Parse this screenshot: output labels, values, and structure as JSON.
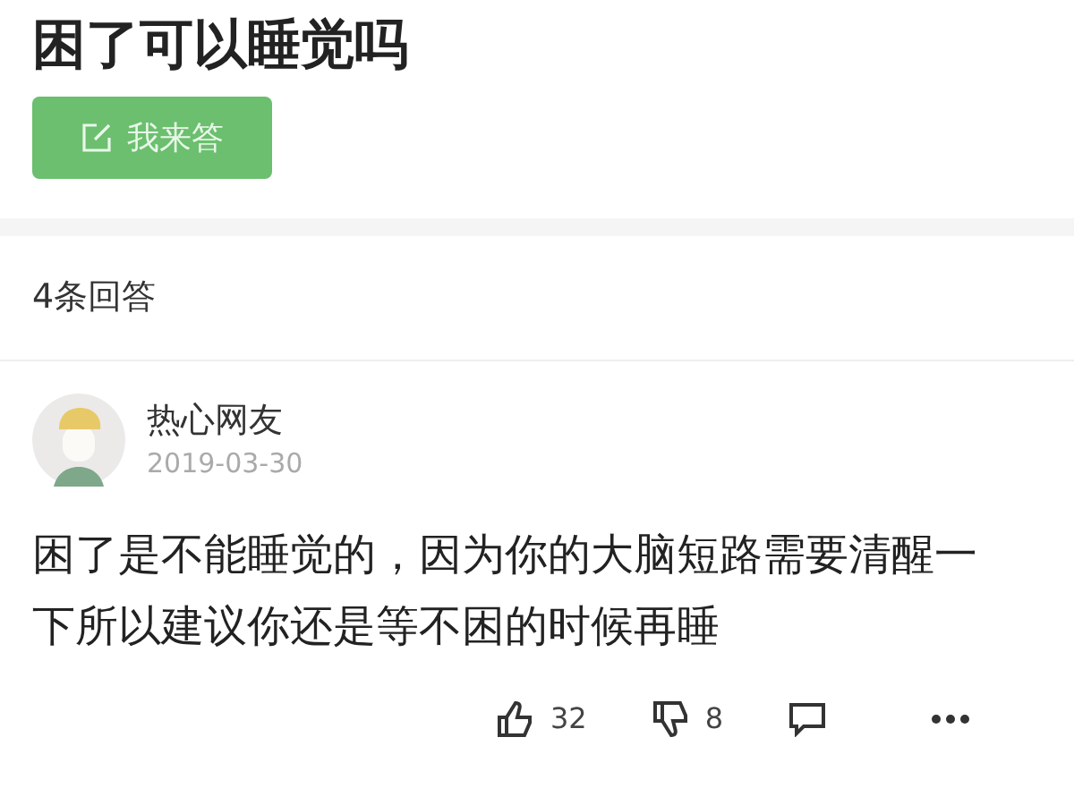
{
  "question": {
    "title": "困了可以睡觉吗"
  },
  "answer_button": {
    "label": "我来答"
  },
  "answer_count": "4条回答",
  "answers": [
    {
      "author": "热心网友",
      "date": "2019-03-30",
      "text": "困了是不能睡觉的，因为你的大脑短路需要清醒一下所以建议你还是等不困的时候再睡",
      "likes": "32",
      "dislikes": "8"
    }
  ]
}
